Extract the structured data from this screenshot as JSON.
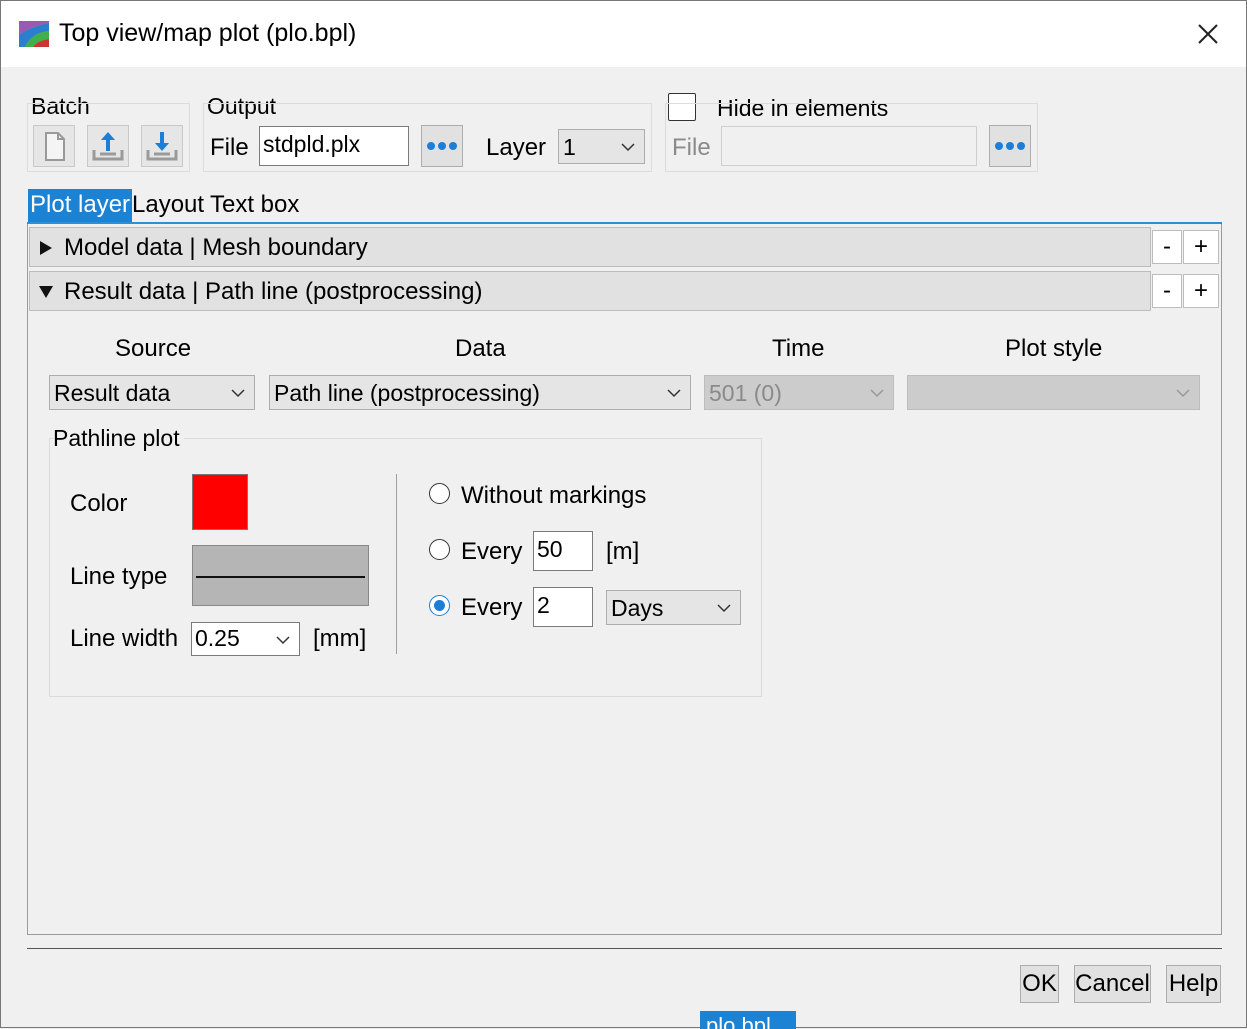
{
  "window": {
    "title": "Top view/map plot (plo.bpl)",
    "close_label": "close"
  },
  "batch": {
    "label": "Batch",
    "buttons": [
      "new-file-icon",
      "export-icon",
      "import-icon"
    ]
  },
  "output": {
    "label": "Output",
    "file_label": "File",
    "file_value": "stdpld.plx",
    "layer_label": "Layer",
    "layer_value": "1"
  },
  "hide_in_elements": {
    "label": "Hide in elements",
    "checked": false,
    "file_label": "File",
    "file_value": ""
  },
  "tabs": [
    {
      "label": "Plot layer",
      "active": true
    },
    {
      "label": "Layout",
      "active": false
    },
    {
      "label": "Text box",
      "active": false
    }
  ],
  "sections": [
    {
      "label": "Model data | Mesh boundary",
      "expanded": false,
      "minus": "-",
      "plus": "+"
    },
    {
      "label": "Result data | Path line (postprocessing)",
      "expanded": true,
      "minus": "-",
      "plus": "+"
    }
  ],
  "columns": {
    "source": {
      "header": "Source",
      "value": "Result data"
    },
    "data": {
      "header": "Data",
      "value": "Path line (postprocessing)"
    },
    "time": {
      "header": "Time",
      "value": "501 (0)"
    },
    "plot_style": {
      "header": "Plot style",
      "value": ""
    }
  },
  "pathline": {
    "label": "Pathline plot",
    "color_label": "Color",
    "color": "#ff0000",
    "line_type_label": "Line type",
    "line_width_label": "Line width",
    "line_width_value": "0.25",
    "line_width_unit": "[mm]",
    "markings": {
      "without_label": "Without markings",
      "every_label": "Every",
      "every_distance_value": "50",
      "every_distance_unit": "[m]",
      "every_time_value": "2",
      "every_time_unit": "Days",
      "selected": "every_time"
    }
  },
  "footer": {
    "ok": "OK",
    "cancel": "Cancel",
    "help": "Help"
  },
  "taskbar": {
    "label": "plo.bpl"
  },
  "colors": {
    "accent": "#1c82d4",
    "background": "#f0f0f0"
  }
}
